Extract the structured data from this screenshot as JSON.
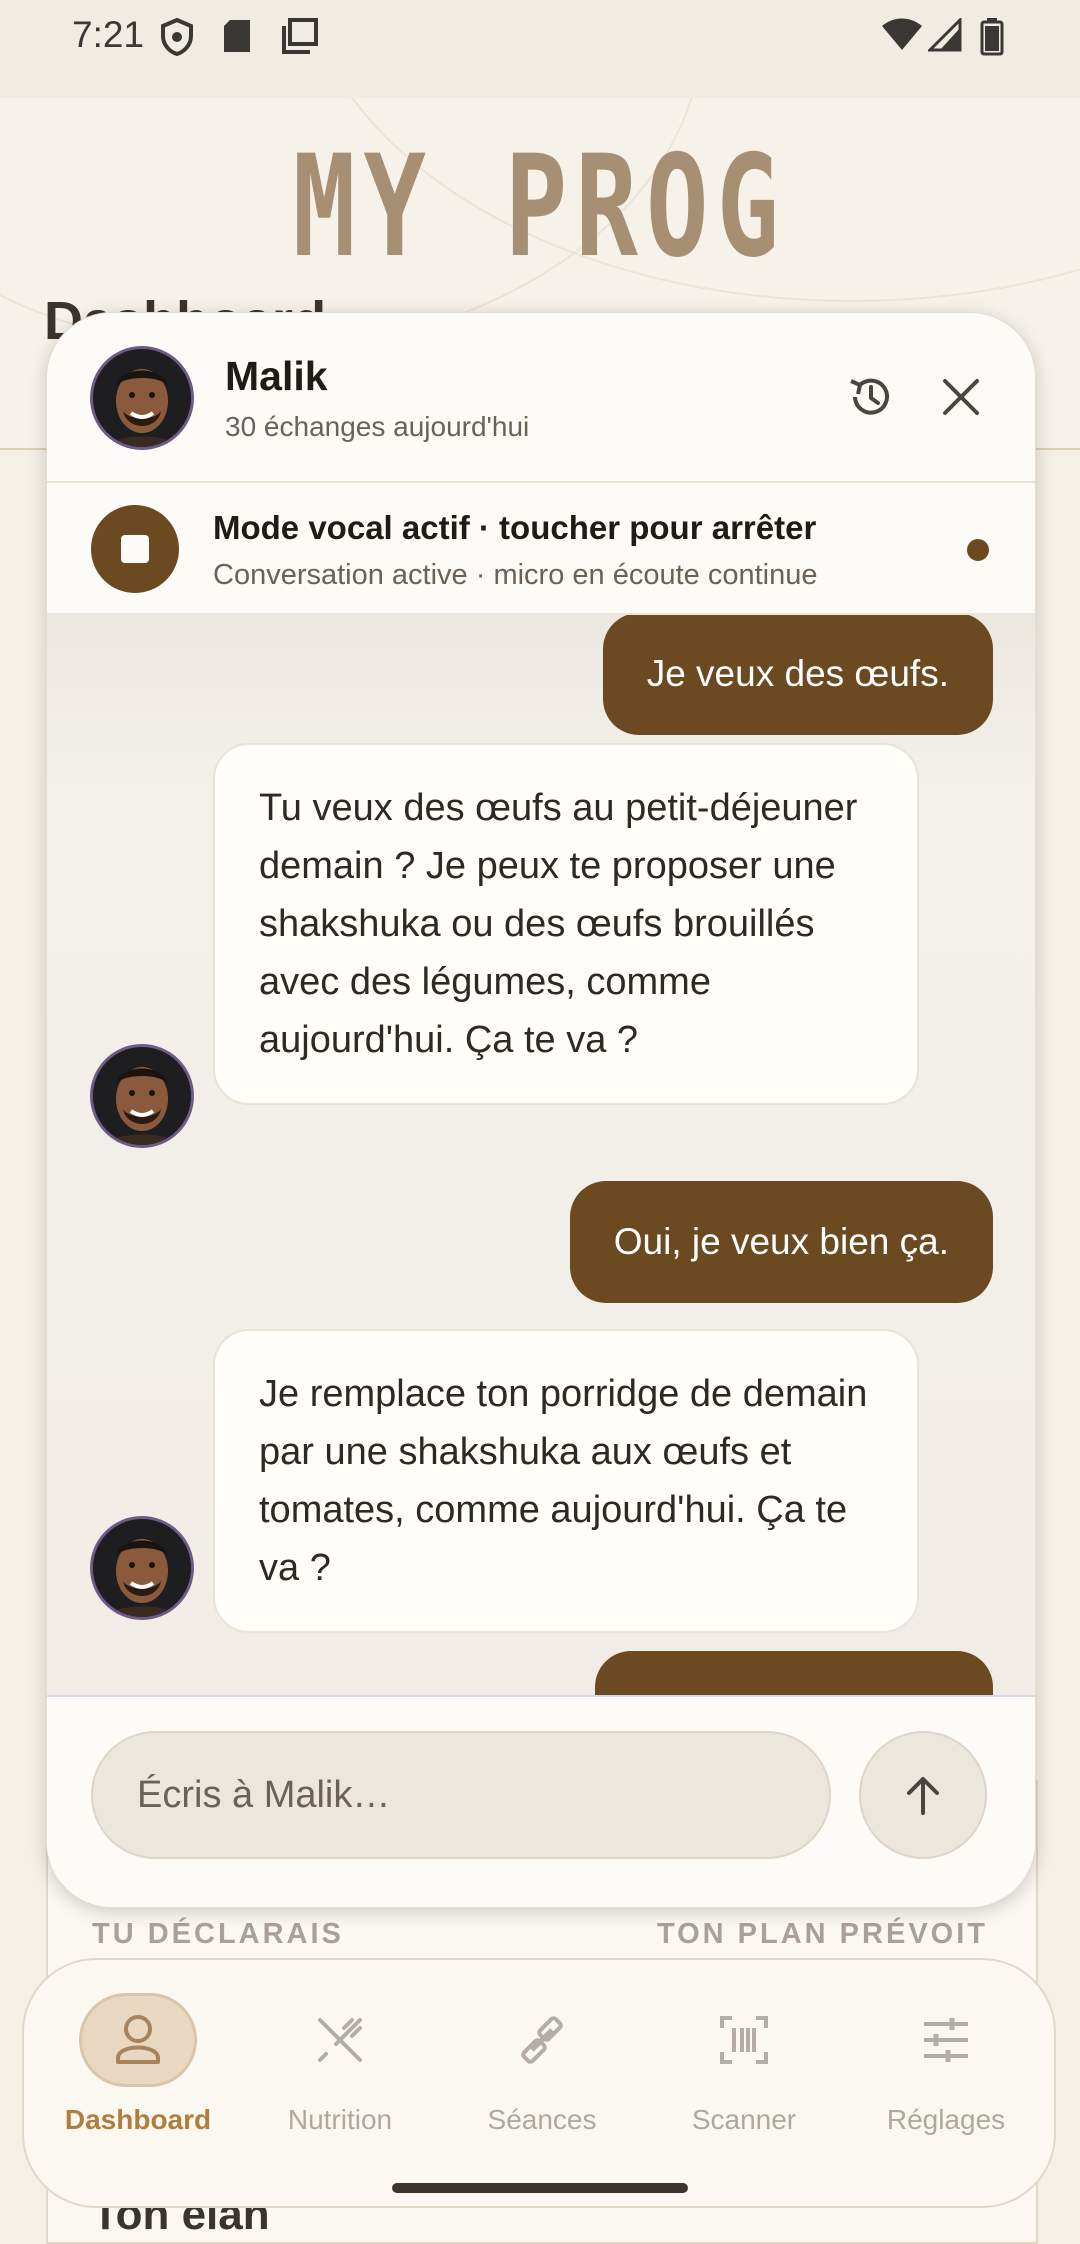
{
  "status_bar": {
    "time": "7:21"
  },
  "background": {
    "logo": "MY PROG",
    "page_title": "Dashboard",
    "card_left_label": "TU DÉCLARAIS",
    "card_right_label": "TON PLAN PRÉVOIT",
    "next_section_title": "Ton élan"
  },
  "chat": {
    "coach_name": "Malik",
    "coach_subtitle": "30 échanges aujourd'hui",
    "voice_mode_title": "Mode vocal actif · toucher pour arrêter",
    "voice_mode_subtitle": "Conversation active · micro en écoute continue",
    "messages": [
      {
        "role": "user",
        "text": "Je veux des œufs."
      },
      {
        "role": "coach",
        "text": "Tu veux des œufs au petit-déjeuner demain ? Je peux te proposer une shakshuka ou des œufs brouillés avec des légumes, comme aujourd'hui. Ça te va ?"
      },
      {
        "role": "user",
        "text": "Oui, je veux bien ça."
      },
      {
        "role": "coach",
        "text": "Je remplace ton porridge de demain par une shakshuka aux œufs et tomates, comme aujourd'hui. Ça te va ?"
      },
      {
        "role": "user",
        "text": ""
      }
    ],
    "input_placeholder": "Écris à Malik…"
  },
  "nav": {
    "items": [
      {
        "label": "Dashboard",
        "icon": "person-icon",
        "active": true
      },
      {
        "label": "Nutrition",
        "icon": "utensils-icon",
        "active": false
      },
      {
        "label": "Séances",
        "icon": "dumbbell-icon",
        "active": false
      },
      {
        "label": "Scanner",
        "icon": "barcode-scan-icon",
        "active": false
      },
      {
        "label": "Réglages",
        "icon": "sliders-icon",
        "active": false
      }
    ]
  },
  "colors": {
    "accent": "#6B4A22",
    "nav_active": "#B07F3E",
    "background": "#F5F0E6"
  }
}
